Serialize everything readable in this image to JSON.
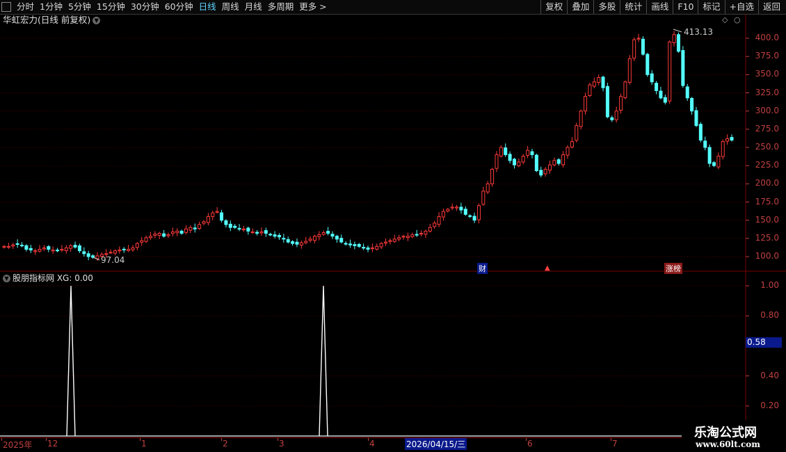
{
  "toolbar": {
    "left_items": [
      "分时",
      "1分钟",
      "5分钟",
      "15分钟",
      "30分钟",
      "60分钟",
      "日线",
      "周线",
      "月线",
      "多周期",
      "更多 >"
    ],
    "active": "日线",
    "right_buttons": [
      "复权",
      "叠加",
      "多股",
      "统计",
      "画线",
      "F10",
      "标记",
      "+自选",
      "返回"
    ]
  },
  "main": {
    "title": "华虹宏力(日线 前复权)",
    "high_label": "413.13",
    "low_label": "97.04",
    "tags": {
      "cai": "财",
      "zb": "涨榜"
    },
    "y_ticks": [
      "400.0",
      "375.0",
      "350.0",
      "325.0",
      "300.0",
      "275.0",
      "250.0",
      "225.0",
      "200.0",
      "175.0",
      "150.0",
      "125.0",
      "100.0"
    ]
  },
  "indicator": {
    "title": "股朋指标网 XG: 0.00",
    "y_ticks": [
      "1.00",
      "0.80",
      "0.40",
      "0.20"
    ],
    "current_value": "0.58"
  },
  "date_axis": {
    "labels": [
      "2025年",
      "12",
      "1",
      "2",
      "3",
      "4",
      "6",
      "7"
    ],
    "current_date": "2026/04/15/三"
  },
  "watermark": {
    "line1": "乐淘公式网",
    "line2": "www.60lt.com"
  },
  "colors": {
    "up": "#ff3a3a",
    "down": "#54ffff",
    "grid": "#7a0000",
    "axis": "#c04040"
  },
  "chart_data": {
    "type": "candlestick",
    "y_range": [
      90,
      415
    ],
    "closes": [
      114,
      114,
      116,
      117,
      115,
      110,
      109,
      108,
      110,
      112,
      110,
      109,
      108,
      110,
      112,
      115,
      113,
      108,
      104,
      100,
      99,
      101,
      103,
      104,
      106,
      108,
      109,
      110,
      110,
      112,
      118,
      122,
      126,
      128,
      131,
      132,
      128,
      130,
      134,
      135,
      132,
      138,
      140,
      138,
      144,
      148,
      155,
      160,
      162,
      150,
      144,
      140,
      140,
      138,
      138,
      135,
      134,
      132,
      134,
      132,
      130,
      128,
      127,
      124,
      120,
      118,
      117,
      119,
      121,
      124,
      128,
      130,
      133,
      132,
      128,
      124,
      120,
      118,
      116,
      115,
      114,
      112,
      110,
      112,
      114,
      118,
      120,
      122,
      124,
      126,
      128,
      128,
      130,
      130,
      132,
      135,
      140,
      146,
      155,
      162,
      165,
      168,
      168,
      164,
      158,
      156,
      150,
      170,
      190,
      200,
      220,
      240,
      250,
      240,
      232,
      226,
      230,
      238,
      246,
      240,
      218,
      212,
      220,
      226,
      232,
      228,
      240,
      250,
      258,
      280,
      300,
      320,
      336,
      340,
      346,
      332,
      292,
      288,
      300,
      320,
      340,
      372,
      398,
      400,
      378,
      350,
      340,
      328,
      318,
      312,
      395,
      405,
      382,
      335,
      318,
      300,
      280,
      260,
      250,
      228,
      225,
      238,
      258,
      262,
      260
    ],
    "signals_at_index": [
      11,
      83
    ],
    "signal_value": 1.0
  }
}
